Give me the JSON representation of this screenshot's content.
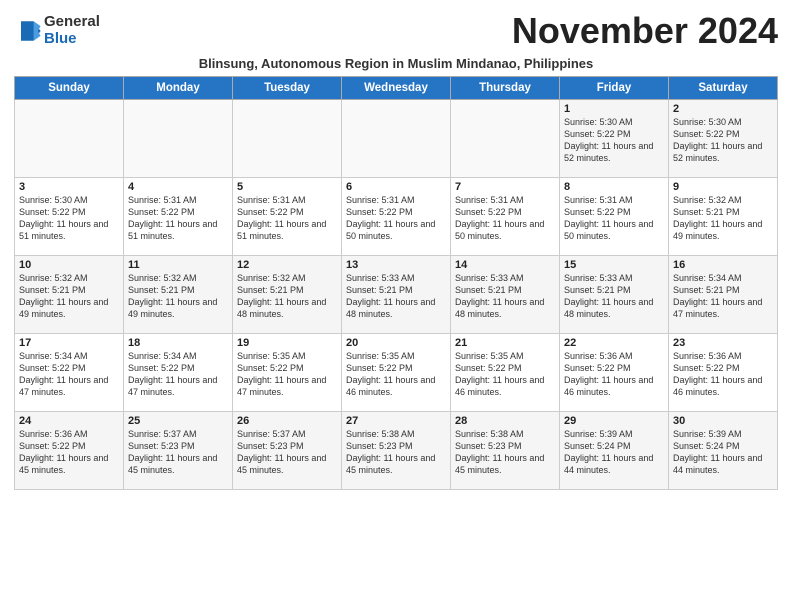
{
  "logo": {
    "general": "General",
    "blue": "Blue"
  },
  "title": "November 2024",
  "subtitle": "Blinsung, Autonomous Region in Muslim Mindanao, Philippines",
  "days_of_week": [
    "Sunday",
    "Monday",
    "Tuesday",
    "Wednesday",
    "Thursday",
    "Friday",
    "Saturday"
  ],
  "weeks": [
    [
      {
        "day": "",
        "info": ""
      },
      {
        "day": "",
        "info": ""
      },
      {
        "day": "",
        "info": ""
      },
      {
        "day": "",
        "info": ""
      },
      {
        "day": "",
        "info": ""
      },
      {
        "day": "1",
        "info": "Sunrise: 5:30 AM\nSunset: 5:22 PM\nDaylight: 11 hours and 52 minutes."
      },
      {
        "day": "2",
        "info": "Sunrise: 5:30 AM\nSunset: 5:22 PM\nDaylight: 11 hours and 52 minutes."
      }
    ],
    [
      {
        "day": "3",
        "info": "Sunrise: 5:30 AM\nSunset: 5:22 PM\nDaylight: 11 hours and 51 minutes."
      },
      {
        "day": "4",
        "info": "Sunrise: 5:31 AM\nSunset: 5:22 PM\nDaylight: 11 hours and 51 minutes."
      },
      {
        "day": "5",
        "info": "Sunrise: 5:31 AM\nSunset: 5:22 PM\nDaylight: 11 hours and 51 minutes."
      },
      {
        "day": "6",
        "info": "Sunrise: 5:31 AM\nSunset: 5:22 PM\nDaylight: 11 hours and 50 minutes."
      },
      {
        "day": "7",
        "info": "Sunrise: 5:31 AM\nSunset: 5:22 PM\nDaylight: 11 hours and 50 minutes."
      },
      {
        "day": "8",
        "info": "Sunrise: 5:31 AM\nSunset: 5:22 PM\nDaylight: 11 hours and 50 minutes."
      },
      {
        "day": "9",
        "info": "Sunrise: 5:32 AM\nSunset: 5:21 PM\nDaylight: 11 hours and 49 minutes."
      }
    ],
    [
      {
        "day": "10",
        "info": "Sunrise: 5:32 AM\nSunset: 5:21 PM\nDaylight: 11 hours and 49 minutes."
      },
      {
        "day": "11",
        "info": "Sunrise: 5:32 AM\nSunset: 5:21 PM\nDaylight: 11 hours and 49 minutes."
      },
      {
        "day": "12",
        "info": "Sunrise: 5:32 AM\nSunset: 5:21 PM\nDaylight: 11 hours and 48 minutes."
      },
      {
        "day": "13",
        "info": "Sunrise: 5:33 AM\nSunset: 5:21 PM\nDaylight: 11 hours and 48 minutes."
      },
      {
        "day": "14",
        "info": "Sunrise: 5:33 AM\nSunset: 5:21 PM\nDaylight: 11 hours and 48 minutes."
      },
      {
        "day": "15",
        "info": "Sunrise: 5:33 AM\nSunset: 5:21 PM\nDaylight: 11 hours and 48 minutes."
      },
      {
        "day": "16",
        "info": "Sunrise: 5:34 AM\nSunset: 5:21 PM\nDaylight: 11 hours and 47 minutes."
      }
    ],
    [
      {
        "day": "17",
        "info": "Sunrise: 5:34 AM\nSunset: 5:22 PM\nDaylight: 11 hours and 47 minutes."
      },
      {
        "day": "18",
        "info": "Sunrise: 5:34 AM\nSunset: 5:22 PM\nDaylight: 11 hours and 47 minutes."
      },
      {
        "day": "19",
        "info": "Sunrise: 5:35 AM\nSunset: 5:22 PM\nDaylight: 11 hours and 47 minutes."
      },
      {
        "day": "20",
        "info": "Sunrise: 5:35 AM\nSunset: 5:22 PM\nDaylight: 11 hours and 46 minutes."
      },
      {
        "day": "21",
        "info": "Sunrise: 5:35 AM\nSunset: 5:22 PM\nDaylight: 11 hours and 46 minutes."
      },
      {
        "day": "22",
        "info": "Sunrise: 5:36 AM\nSunset: 5:22 PM\nDaylight: 11 hours and 46 minutes."
      },
      {
        "day": "23",
        "info": "Sunrise: 5:36 AM\nSunset: 5:22 PM\nDaylight: 11 hours and 46 minutes."
      }
    ],
    [
      {
        "day": "24",
        "info": "Sunrise: 5:36 AM\nSunset: 5:22 PM\nDaylight: 11 hours and 45 minutes."
      },
      {
        "day": "25",
        "info": "Sunrise: 5:37 AM\nSunset: 5:23 PM\nDaylight: 11 hours and 45 minutes."
      },
      {
        "day": "26",
        "info": "Sunrise: 5:37 AM\nSunset: 5:23 PM\nDaylight: 11 hours and 45 minutes."
      },
      {
        "day": "27",
        "info": "Sunrise: 5:38 AM\nSunset: 5:23 PM\nDaylight: 11 hours and 45 minutes."
      },
      {
        "day": "28",
        "info": "Sunrise: 5:38 AM\nSunset: 5:23 PM\nDaylight: 11 hours and 45 minutes."
      },
      {
        "day": "29",
        "info": "Sunrise: 5:39 AM\nSunset: 5:24 PM\nDaylight: 11 hours and 44 minutes."
      },
      {
        "day": "30",
        "info": "Sunrise: 5:39 AM\nSunset: 5:24 PM\nDaylight: 11 hours and 44 minutes."
      }
    ]
  ]
}
